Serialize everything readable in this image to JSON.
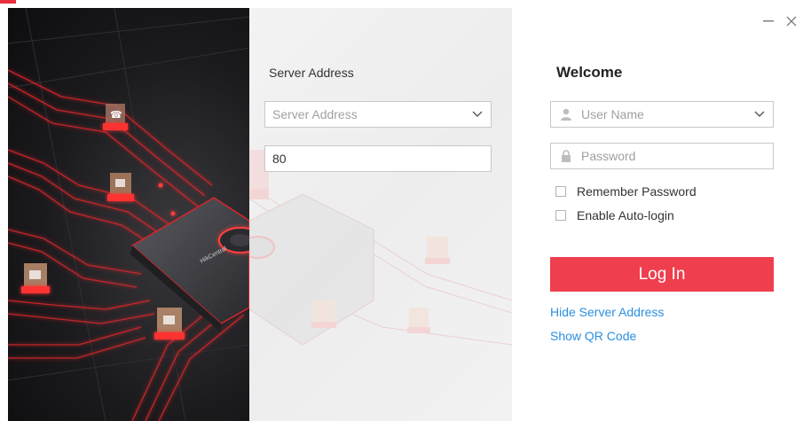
{
  "server": {
    "label": "Server Address",
    "address_placeholder": "Server Address",
    "port_value": "80"
  },
  "login": {
    "welcome": "Welcome",
    "username_placeholder": "User Name",
    "password_placeholder": "Password",
    "remember_label": "Remember Password",
    "autologin_label": "Enable Auto-login",
    "login_button": "Log In",
    "hide_server_link": "Hide Server Address",
    "show_qr_link": "Show QR Code"
  },
  "window_controls": {
    "minimize": "—",
    "close": "✕"
  },
  "hero": {
    "device_label": "HikCentral"
  },
  "colors": {
    "accent": "#ef3e4e",
    "link": "#2b8fe0",
    "glow": "#ff3b3b"
  },
  "icons": {
    "dropdown": "chevron-down-icon",
    "user": "user-icon",
    "password": "lock-icon"
  }
}
